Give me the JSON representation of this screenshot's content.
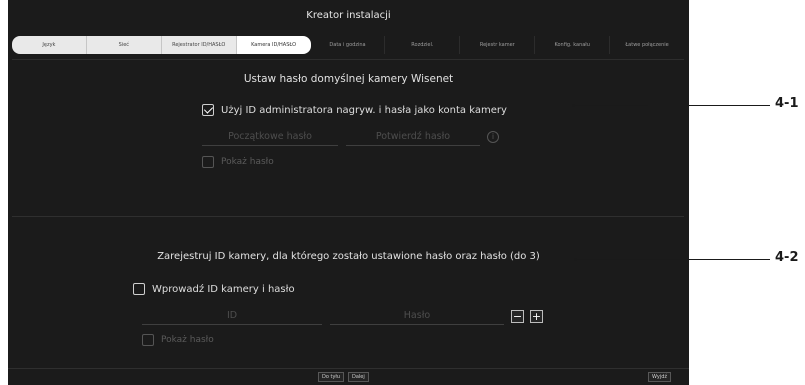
{
  "window": {
    "title": "Kreator instalacji"
  },
  "tabs": [
    {
      "label": "Język",
      "state": "past"
    },
    {
      "label": "Sieć",
      "state": "past"
    },
    {
      "label": "Rejestrator ID/HASŁO",
      "state": "past"
    },
    {
      "label": "Kamera ID/HASŁO",
      "state": "active"
    },
    {
      "label": "Data i godzina",
      "state": "upcoming"
    },
    {
      "label": "Rozdziel.",
      "state": "upcoming"
    },
    {
      "label": "Rejestr kamer",
      "state": "upcoming"
    },
    {
      "label": "Konfig. kanału",
      "state": "upcoming"
    },
    {
      "label": "Łatwe połączenie",
      "state": "upcoming"
    }
  ],
  "section1": {
    "heading": "Ustaw hasło domyślnej kamery Wisenet",
    "use_admin_label": "Użyj ID administratora nagryw. i hasła jako konta kamery",
    "use_admin_checked": true,
    "initial_password_placeholder": "Początkowe hasło",
    "confirm_password_placeholder": "Potwierdź hasło",
    "info_glyph": "i",
    "show_password_label": "Pokaż hasło",
    "show_password_checked": false
  },
  "section2": {
    "heading": "Zarejestruj ID kamery, dla którego zostało ustawione hasło oraz hasło (do 3)",
    "enter_id_label": "Wprowadź ID kamery i hasło",
    "enter_id_checked": false,
    "id_placeholder": "ID",
    "password_placeholder": "Hasło",
    "minus_glyph": "−",
    "plus_glyph": "+",
    "show_password_label": "Pokaż hasło",
    "show_password_checked": false
  },
  "footer": {
    "back_label": "Do tyłu",
    "next_label": "Dalej",
    "exit_label": "Wyjdź"
  },
  "callouts": {
    "c1": "4-1",
    "c2": "4-2"
  }
}
